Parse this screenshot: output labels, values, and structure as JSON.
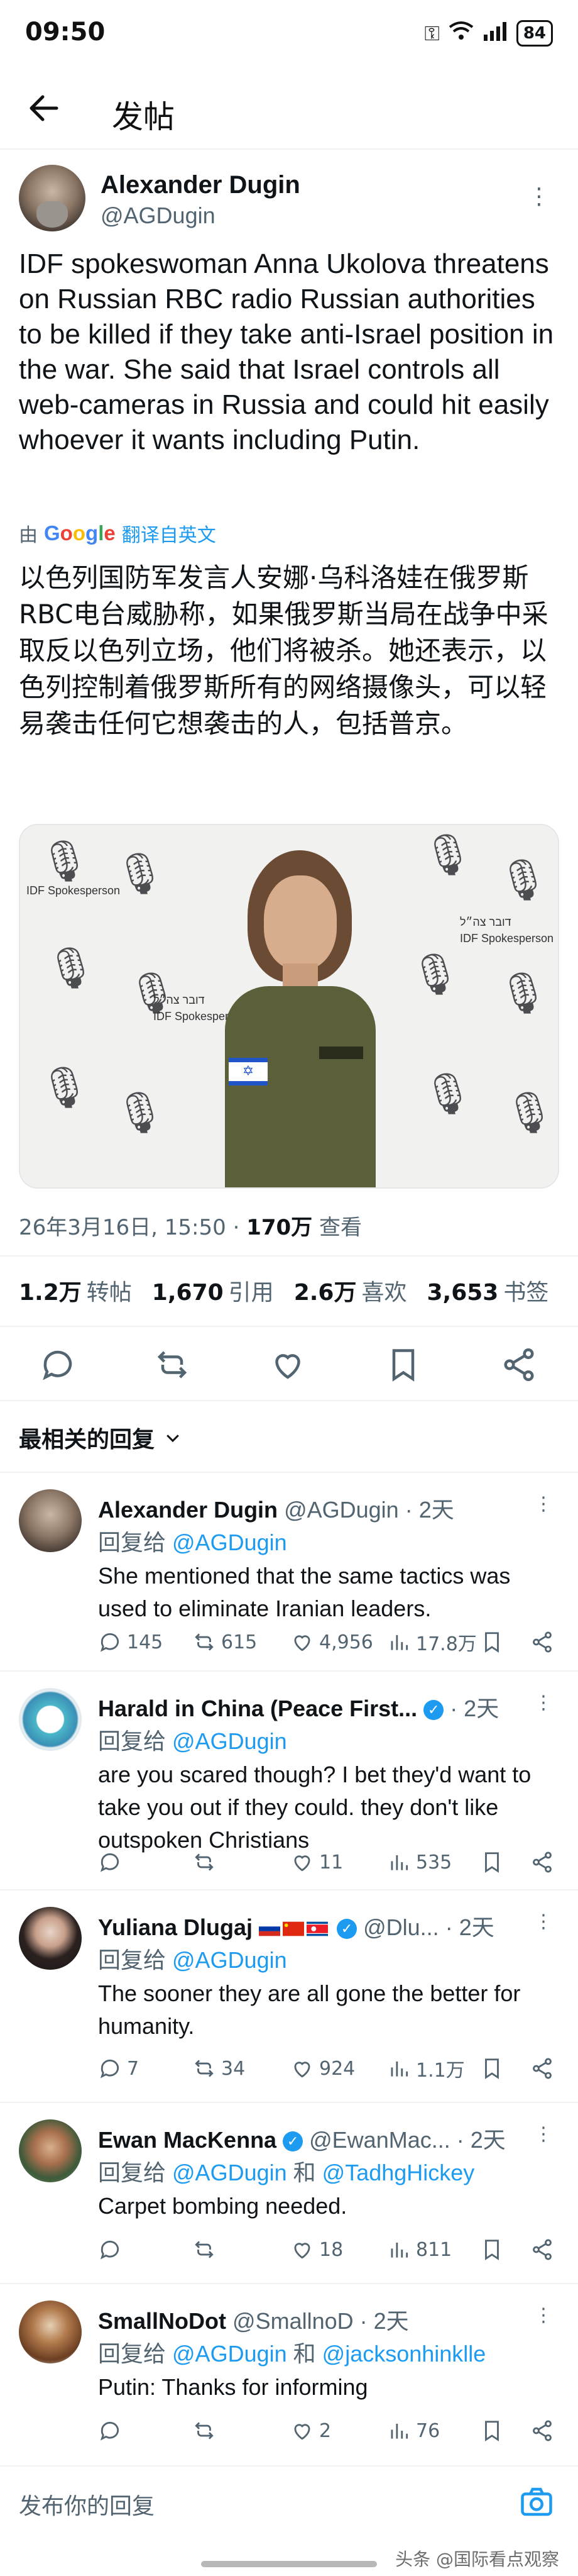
{
  "status_bar": {
    "time": "09:50",
    "icons": [
      "key-icon",
      "wifi-icon",
      "signal-icon",
      "hd-icon"
    ],
    "battery": "84"
  },
  "nav": {
    "title": "发帖"
  },
  "tweet": {
    "author_name": "Alexander Dugin",
    "author_handle": "@AGDugin",
    "text": "IDF spokeswoman Anna Ukolova threatens on Russian RBC radio Russian authorities to be killed if they take anti-Israel position in the war. She said that Israel controls all web-cameras in Russia and could hit easily whoever  it wants including Putin.",
    "translate_by": "由",
    "translate_label": "翻译自英文",
    "translated_text": "以色列国防军发言人安娜·乌科洛娃在俄罗斯RBC电台威胁称，如果俄罗斯当局在战争中采取反以色列立场，他们将被杀。她还表示，以色列控制着俄罗斯所有的网络摄像头，可以轻易袭击任何它想袭击的人，包括普京。",
    "media_texts": [
      "IDF Spokesperson",
      "דובר צה״ל"
    ],
    "timestamp": "26年3月16日, 15:50 · ",
    "views_count": "170万",
    "views_label": " 查看"
  },
  "stats": [
    {
      "num": "1.2万",
      "label": "转帖"
    },
    {
      "num": "1,670",
      "label": "引用"
    },
    {
      "num": "2.6万",
      "label": "喜欢"
    },
    {
      "num": "3,653",
      "label": "书签"
    }
  ],
  "actions": [
    "reply-icon",
    "retweet-icon",
    "like-icon",
    "bookmark-icon",
    "share-icon"
  ],
  "sort": {
    "label": "最相关的回复"
  },
  "replies": [
    {
      "name": "Alexander Dugin",
      "handle": "@AGDugin",
      "time": "· 2天",
      "reply_prefix": "回复给 ",
      "mention": "@AGDugin",
      "text": "She mentioned that the same tactics was used to eliminate Iranian leaders.",
      "stats": {
        "reply": "145",
        "retweet": "615",
        "like": "4,956",
        "views": "17.8万"
      }
    },
    {
      "name": "Harald in China (Peace First...",
      "handle": "",
      "time": "· 2天",
      "reply_prefix": "回复给 ",
      "mention": "@AGDugin",
      "text": "are you scared though? I bet they'd want to take you out if they could. they don't like outspoken Christians",
      "stats": {
        "reply": "",
        "retweet": "",
        "like": "11",
        "views": "535"
      }
    },
    {
      "name": "Yuliana Dlugaj",
      "handle": "@Dlu...",
      "time": "· 2天",
      "reply_prefix": "回复给 ",
      "mention": "@AGDugin",
      "text": "The sooner they are all gone the better for humanity.",
      "stats": {
        "reply": "7",
        "retweet": "34",
        "like": "924",
        "views": "1.1万"
      }
    },
    {
      "name": "Ewan MacKenna",
      "handle": "@EwanMac...",
      "time": "· 2天",
      "reply_prefix": "回复给 ",
      "mention": "@AGDugin",
      "and": " 和 ",
      "mention2": "@TadhgHickey",
      "text": "Carpet bombing needed.",
      "stats": {
        "reply": "",
        "retweet": "",
        "like": "18",
        "views": "811"
      }
    },
    {
      "name": "SmallNoDot",
      "handle": "@SmallnoD",
      "time": "· 2天",
      "reply_prefix": "回复给 ",
      "mention": "@AGDugin",
      "and": " 和 ",
      "mention2": "@jacksonhinklle",
      "text": "Putin: Thanks for informing",
      "stats": {
        "reply": "",
        "retweet": "",
        "like": "2",
        "views": "76"
      }
    }
  ],
  "compose": {
    "placeholder": "发布你的回复"
  },
  "watermark": "头条 @国际看点观察"
}
